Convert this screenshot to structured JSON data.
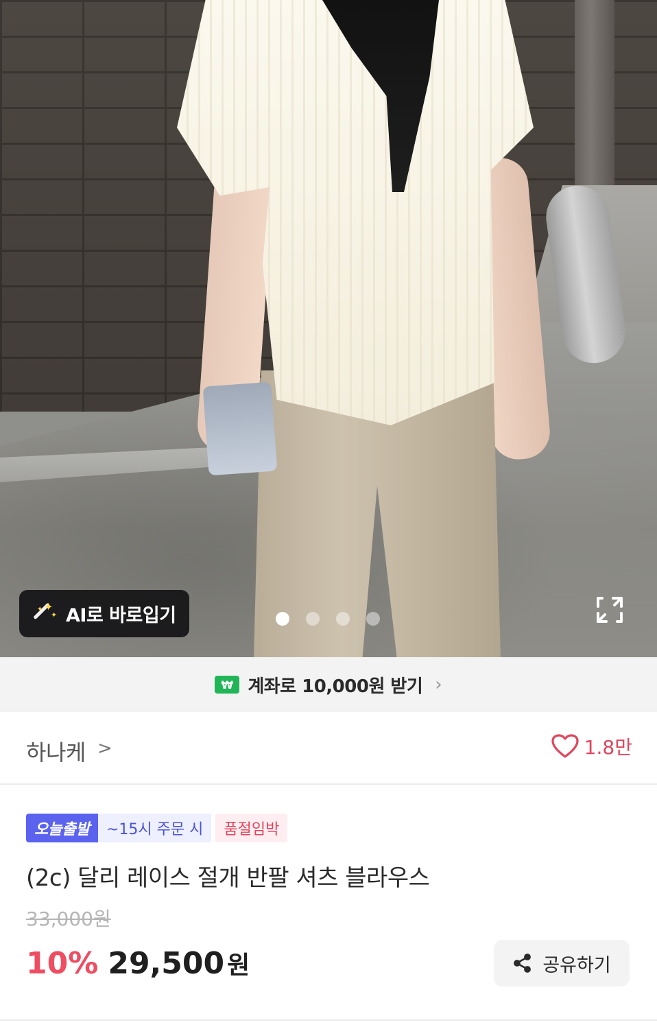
{
  "hero": {
    "ai_try_on_label": "AI로 바로입기",
    "carousel": {
      "total_slides": 4,
      "active_index": 0
    }
  },
  "banner": {
    "badge": "₩",
    "text": "계좌로 10,000원 받기",
    "chevron": "›"
  },
  "shop": {
    "name": "하나케",
    "chevron": ">",
    "like_count": "1.8만"
  },
  "product": {
    "tags": {
      "today_shipping": "오늘출발",
      "order_cutoff": "~15시 주문 시",
      "low_stock": "품절임박"
    },
    "title": "(2c) 달리 레이스 절개 반팔 셔츠 블라우스",
    "original_price": "33,000원",
    "discount": "10%",
    "price": "29,500",
    "currency": "원",
    "share_label": "공유하기"
  },
  "colors": {
    "accent_red": "#ee4d62",
    "today_tag": "#5a62ee",
    "banner_badge": "#22b557"
  },
  "icons": [
    "magic-wand-icon",
    "expand-icon",
    "won-icon",
    "heart-icon",
    "share-icon",
    "chevron-right-icon"
  ]
}
